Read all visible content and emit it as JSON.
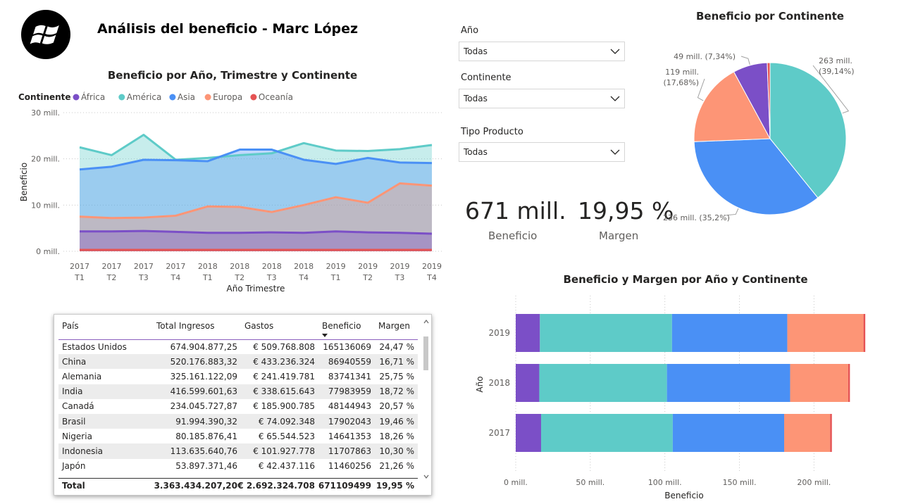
{
  "page": {
    "title": "Análisis del beneficio - Marc López"
  },
  "colors": {
    "africa": "#7b4fc7",
    "america": "#5ecbc8",
    "asia": "#4a90f5",
    "europa": "#fd9576",
    "oceania": "#e55353"
  },
  "logo": {
    "icon": "windows-logo-icon"
  },
  "slicers": [
    {
      "label": "Año",
      "value": "Todas"
    },
    {
      "label": "Continente",
      "value": "Todas"
    },
    {
      "label": "Tipo Producto",
      "value": "Todas"
    }
  ],
  "kpis": {
    "beneficio": {
      "value": "671 mill.",
      "label": "Beneficio"
    },
    "margen": {
      "value": "19,95 %",
      "label": "Margen"
    }
  },
  "chart_data": [
    {
      "type": "area",
      "title": "Beneficio por Año, Trimestre y Continente",
      "legend_title": "Continente",
      "legend_position": "top-left",
      "xlabel": "Año Trimestre",
      "ylabel": "Beneficio",
      "categories": [
        "2017 T1",
        "2017 T2",
        "2017 T3",
        "2017 T4",
        "2018 T1",
        "2018 T2",
        "2018 T3",
        "2018 T4",
        "2019 T1",
        "2019 T2",
        "2019 T3",
        "2019 T4"
      ],
      "ylim": [
        0,
        30
      ],
      "yticks": [
        "0 mill.",
        "10 mill.",
        "20 mill.",
        "30 mill."
      ],
      "grid": true,
      "series": [
        {
          "name": "África",
          "values": [
            4.3,
            4.3,
            4.4,
            4.2,
            4.0,
            4.0,
            4.1,
            4.0,
            4.3,
            4.1,
            4.0,
            3.8
          ]
        },
        {
          "name": "América",
          "values": [
            22.5,
            20.8,
            25.2,
            19.8,
            20.2,
            20.8,
            21.2,
            23.4,
            21.8,
            21.7,
            22.1,
            23.0
          ]
        },
        {
          "name": "Asia",
          "values": [
            17.7,
            18.3,
            19.8,
            19.7,
            19.5,
            22.0,
            22.0,
            19.8,
            18.9,
            20.2,
            19.2,
            19.1
          ]
        },
        {
          "name": "Europa",
          "values": [
            7.5,
            7.2,
            7.3,
            7.7,
            9.7,
            9.6,
            8.5,
            10.0,
            11.7,
            10.5,
            14.7,
            14.2
          ]
        },
        {
          "name": "Oceanía",
          "values": [
            0.3,
            0.3,
            0.3,
            0.3,
            0.3,
            0.3,
            0.3,
            0.3,
            0.3,
            0.3,
            0.3,
            0.3
          ]
        }
      ]
    },
    {
      "type": "pie",
      "title": "Beneficio por Continente",
      "slices": [
        {
          "name": "América",
          "value": 263,
          "label1": "263 mill.",
          "label2": "(39,14%)"
        },
        {
          "name": "Asia",
          "value": 236,
          "label1": "236 mill. (35,2%)"
        },
        {
          "name": "Europa",
          "value": 119,
          "label1": "119 mill.",
          "label2": "(17,68%)"
        },
        {
          "name": "África",
          "value": 49,
          "label1": "49 mill. (7,34%)"
        },
        {
          "name": "Oceanía",
          "value": 4
        }
      ]
    },
    {
      "type": "bar",
      "orientation": "horizontal",
      "stacked": true,
      "title": "Beneficio y Margen por Año y Continente",
      "xlabel": "Beneficio",
      "ylabel": "Año",
      "categories": [
        "2019",
        "2018",
        "2017"
      ],
      "xlim": [
        0,
        240
      ],
      "xticks": [
        "0 mill.",
        "50 mill.",
        "100 mill.",
        "150 mill.",
        "200 mill."
      ],
      "series": [
        {
          "name": "África",
          "values": [
            16.2,
            15.8,
            17.0
          ]
        },
        {
          "name": "América",
          "values": [
            88.6,
            85.6,
            88.3
          ]
        },
        {
          "name": "Asia",
          "values": [
            77.3,
            82.6,
            74.7
          ]
        },
        {
          "name": "Europa",
          "values": [
            51.1,
            38.9,
            30.8
          ]
        },
        {
          "name": "Oceanía",
          "values": [
            1.2,
            1.2,
            1.2
          ]
        }
      ]
    }
  ],
  "table": {
    "columns": [
      "País",
      "Total Ingresos",
      "Gastos",
      "Beneficio",
      "Margen"
    ],
    "sort_column": "Beneficio",
    "rows": [
      [
        "Estados Unidos",
        "674.904.877,25",
        "€ 509.768.808",
        "165136069",
        "24,47 %"
      ],
      [
        "China",
        "520.176.883,32",
        "€ 433.236.324",
        "86940559",
        "16,71 %"
      ],
      [
        "Alemania",
        "325.161.122,09",
        "€ 241.419.781",
        "83741341",
        "25,75 %"
      ],
      [
        "India",
        "416.599.601,63",
        "€ 338.615.643",
        "77983959",
        "18,72 %"
      ],
      [
        "Canadá",
        "234.045.727,87",
        "€ 185.900.785",
        "48144943",
        "20,57 %"
      ],
      [
        "Brasil",
        "91.994.390,32",
        "€ 74.092.348",
        "17902043",
        "19,46 %"
      ],
      [
        "Nigeria",
        "80.185.876,41",
        "€ 65.544.523",
        "14641353",
        "18,26 %"
      ],
      [
        "Indonesia",
        "113.635.640,76",
        "€ 101.927.778",
        "11707863",
        "10,30 %"
      ],
      [
        "Japón",
        "53.897.371,46",
        "€ 42.437.116",
        "11460256",
        "21,26 %"
      ]
    ],
    "total": [
      "Total",
      "3.363.434.207,20",
      "€ 2.692.324.708",
      "671109499",
      "19,95 %"
    ]
  }
}
